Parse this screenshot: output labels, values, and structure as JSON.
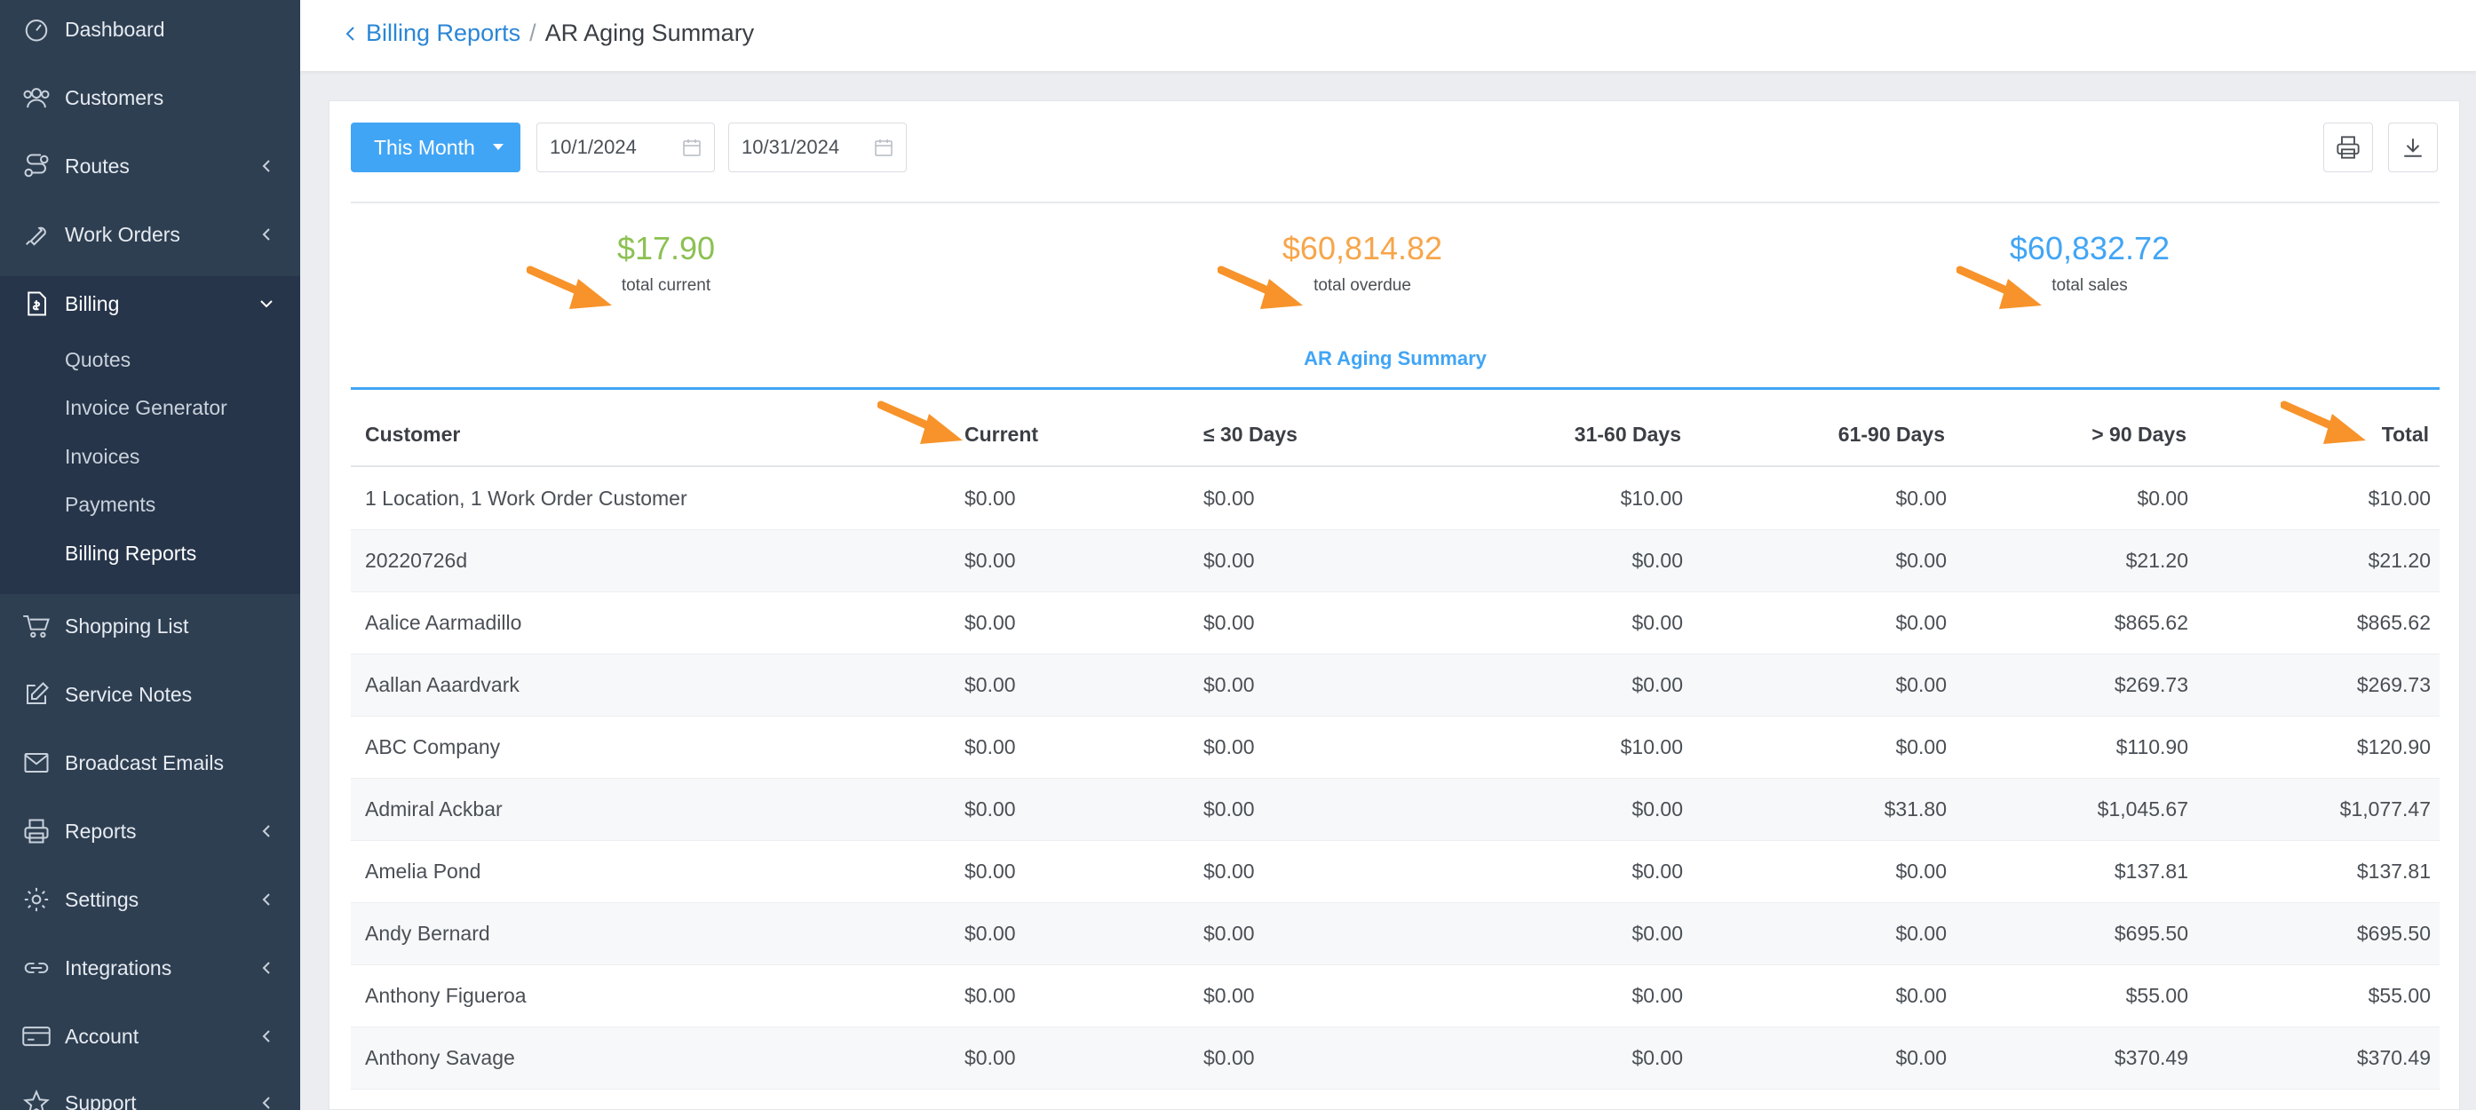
{
  "sidebar": {
    "items": [
      {
        "label": "Dashboard",
        "icon": "dashboard-icon"
      },
      {
        "label": "Customers",
        "icon": "customers-icon"
      },
      {
        "label": "Routes",
        "icon": "routes-icon"
      },
      {
        "label": "Work Orders",
        "icon": "wrench-icon"
      },
      {
        "label": "Billing",
        "icon": "billing-icon"
      },
      {
        "label": "Shopping List",
        "icon": "cart-icon"
      },
      {
        "label": "Service Notes",
        "icon": "edit-icon"
      },
      {
        "label": "Broadcast Emails",
        "icon": "mail-icon"
      },
      {
        "label": "Reports",
        "icon": "printer-icon"
      },
      {
        "label": "Settings",
        "icon": "gear-icon"
      },
      {
        "label": "Integrations",
        "icon": "link-icon"
      },
      {
        "label": "Account",
        "icon": "card-icon"
      },
      {
        "label": "Support",
        "icon": "star-icon"
      }
    ],
    "billing_sub": [
      "Quotes",
      "Invoice Generator",
      "Invoices",
      "Payments",
      "Billing Reports"
    ]
  },
  "breadcrumb": {
    "parent": "Billing Reports",
    "separator": "/",
    "current": "AR Aging Summary"
  },
  "toolbar": {
    "period": "This Month",
    "start_date": "10/1/2024",
    "end_date": "10/31/2024"
  },
  "stats": [
    {
      "value": "$17.90",
      "caption": "total current",
      "color": "#8cc152"
    },
    {
      "value": "$60,814.82",
      "caption": "total overdue",
      "color": "#f7a54a"
    },
    {
      "value": "$60,832.72",
      "caption": "total sales",
      "color": "#41a5f5"
    }
  ],
  "report_title": "AR Aging Summary",
  "table": {
    "headers": [
      "Customer",
      "Current",
      "≤ 30 Days",
      "31-60 Days",
      "61-90 Days",
      "> 90 Days",
      "Total"
    ],
    "rows": [
      [
        "1 Location, 1 Work Order Customer",
        "$0.00",
        "$0.00",
        "$10.00",
        "$0.00",
        "$0.00",
        "$10.00"
      ],
      [
        "20220726d",
        "$0.00",
        "$0.00",
        "$0.00",
        "$0.00",
        "$21.20",
        "$21.20"
      ],
      [
        "Aalice Aarmadillo",
        "$0.00",
        "$0.00",
        "$0.00",
        "$0.00",
        "$865.62",
        "$865.62"
      ],
      [
        "Aallan Aaardvark",
        "$0.00",
        "$0.00",
        "$0.00",
        "$0.00",
        "$269.73",
        "$269.73"
      ],
      [
        "ABC Company",
        "$0.00",
        "$0.00",
        "$10.00",
        "$0.00",
        "$110.90",
        "$120.90"
      ],
      [
        "Admiral Ackbar",
        "$0.00",
        "$0.00",
        "$0.00",
        "$31.80",
        "$1,045.67",
        "$1,077.47"
      ],
      [
        "Amelia Pond",
        "$0.00",
        "$0.00",
        "$0.00",
        "$0.00",
        "$137.81",
        "$137.81"
      ],
      [
        "Andy Bernard",
        "$0.00",
        "$0.00",
        "$0.00",
        "$0.00",
        "$695.50",
        "$695.50"
      ],
      [
        "Anthony Figueroa",
        "$0.00",
        "$0.00",
        "$0.00",
        "$0.00",
        "$55.00",
        "$55.00"
      ],
      [
        "Anthony Savage",
        "$0.00",
        "$0.00",
        "$0.00",
        "$0.00",
        "$370.49",
        "$370.49"
      ]
    ]
  },
  "colors": {
    "accent": "#41a5f5",
    "annotation_arrow": "#f7932a",
    "sidebar": "#2f3f52"
  }
}
